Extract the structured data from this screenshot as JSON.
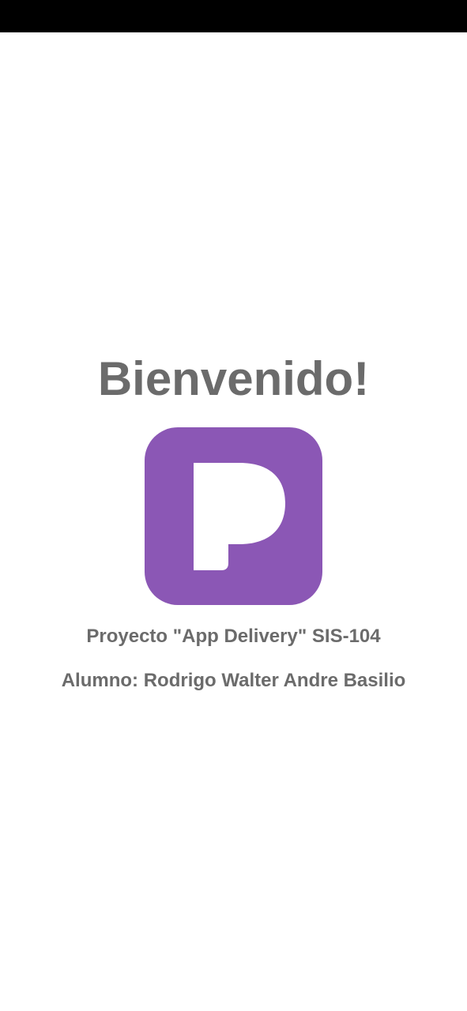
{
  "screen": {
    "title": "Bienvenido!",
    "project_text": "Proyecto \"App Delivery\" SIS-104",
    "student_text": "Alumno: Rodrigo Walter Andre Basilio"
  },
  "logo": {
    "icon": "app-logo-p-icon",
    "letter": "P"
  },
  "colors": {
    "text": "#6b6b6b",
    "brand": "#8b57b5",
    "status_bar": "#000000",
    "background": "#ffffff"
  }
}
